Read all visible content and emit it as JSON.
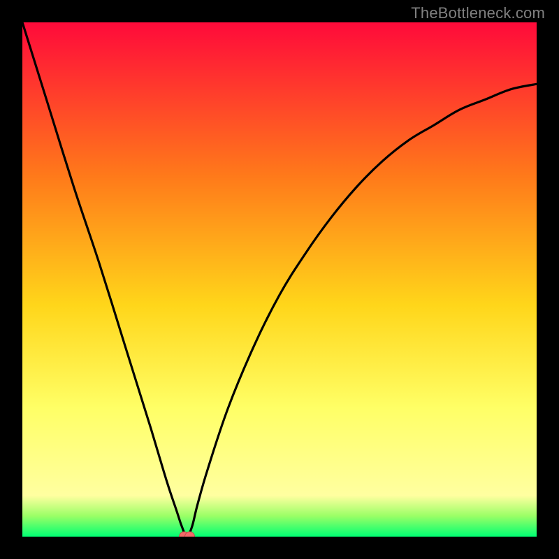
{
  "watermark": "TheBottleneck.com",
  "colors": {
    "frame": "#000000",
    "gradient_top": "#ff0a3a",
    "gradient_mid_upper": "#ff7a1a",
    "gradient_mid": "#ffd61a",
    "gradient_lower": "#ffff66",
    "gradient_bottom1": "#9aff66",
    "gradient_bottom2": "#00ff73",
    "curve": "#000000",
    "marker_fill": "#f46a6a",
    "marker_stroke": "#c94b4b"
  },
  "chart_data": {
    "type": "line",
    "title": "",
    "xlabel": "",
    "ylabel": "",
    "xlim": [
      0,
      100
    ],
    "ylim": [
      0,
      100
    ],
    "grid": false,
    "legend": false,
    "series": [
      {
        "name": "bottleneck-curve",
        "x": [
          0,
          5,
          10,
          15,
          20,
          25,
          28,
          30,
          31,
          32,
          33,
          34,
          36,
          40,
          45,
          50,
          55,
          60,
          65,
          70,
          75,
          80,
          85,
          90,
          95,
          100
        ],
        "y": [
          100,
          84,
          68,
          53,
          37,
          21,
          11,
          5,
          2,
          0,
          2,
          6,
          13,
          25,
          37,
          47,
          55,
          62,
          68,
          73,
          77,
          80,
          83,
          85,
          87,
          88
        ]
      }
    ],
    "markers": [
      {
        "name": "optimal-point",
        "x": 32,
        "y": 0
      }
    ],
    "gradient_stops_pct": [
      0,
      30,
      55,
      75,
      92,
      96,
      100
    ]
  }
}
